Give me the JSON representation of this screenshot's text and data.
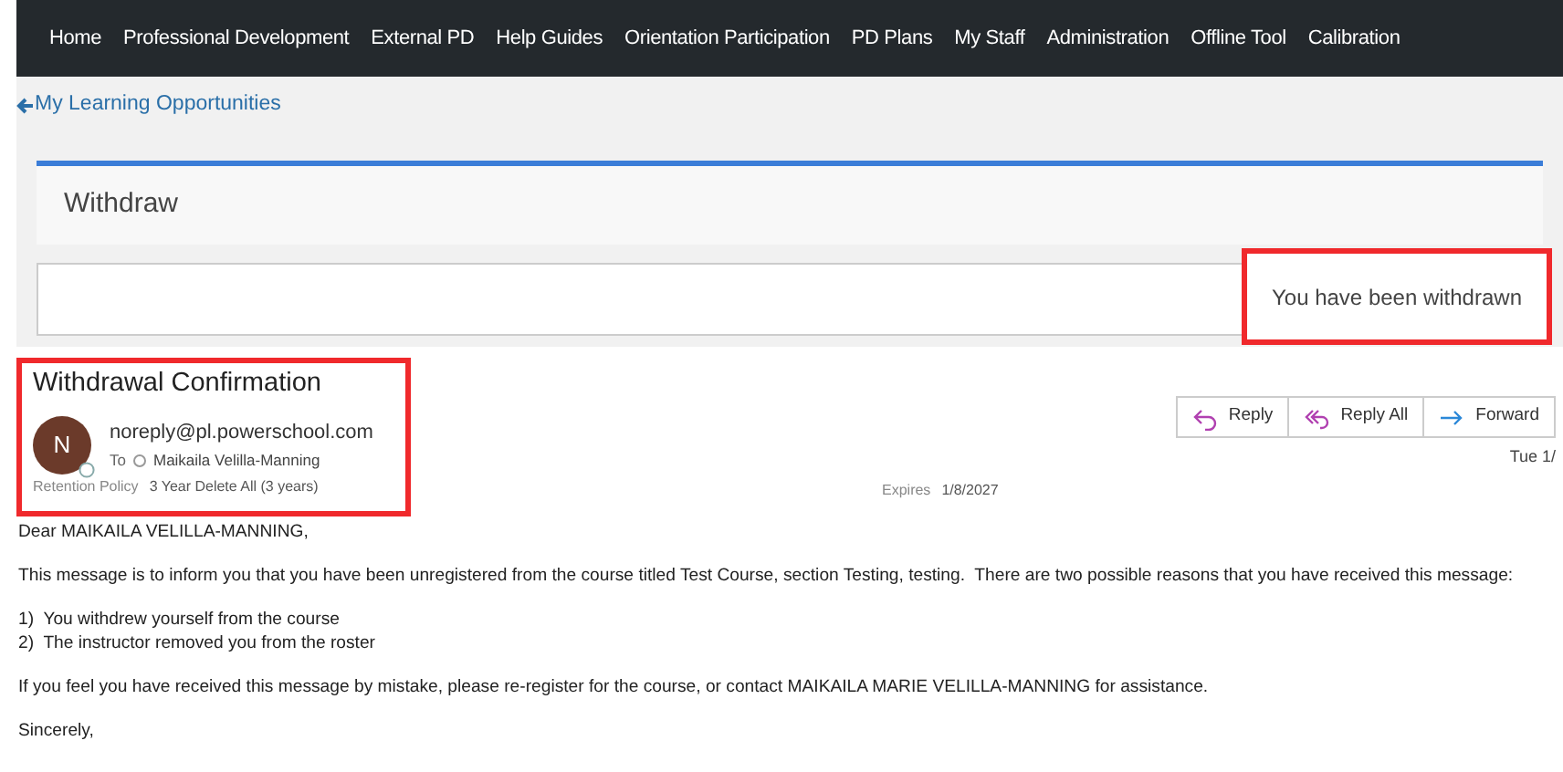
{
  "nav": {
    "items": [
      "Home",
      "Professional Development",
      "External PD",
      "Help Guides",
      "Orientation Participation",
      "PD Plans",
      "My Staff",
      "Administration",
      "Offline Tool",
      "Calibration"
    ]
  },
  "back_link": "My Learning Opportunities",
  "panel": {
    "title": "Withdraw",
    "status": "You have been withdrawn"
  },
  "email": {
    "subject": "Withdrawal Confirmation",
    "avatar": "N",
    "from": "noreply@pl.powerschool.com",
    "to_label": "To",
    "to": "Maikaila Velilla-Manning",
    "retention_label": "Retention Policy",
    "retention": "3 Year Delete All (3 years)",
    "expires_label": "Expires",
    "expires": "1/8/2027",
    "date": "Tue 1/",
    "actions": [
      {
        "kind": "reply",
        "label": "Reply"
      },
      {
        "kind": "reply_all",
        "label": "Reply All"
      },
      {
        "kind": "forward",
        "label": "Forward"
      }
    ],
    "body": [
      "Dear MAIKAILA VELILLA-MANNING,",
      "This message is to inform you that you have been unregistered from the course titled Test Course, section Testing, testing.  There are two possible reasons that you have received this message:",
      "1)  You withdrew yourself from the course\n2)  The instructor removed you from the roster",
      "If you feel you have received this message by mistake, please re-register for the course, or contact MAIKAILA MARIE VELILLA-MANNING for assistance.",
      "Sincerely,"
    ]
  }
}
